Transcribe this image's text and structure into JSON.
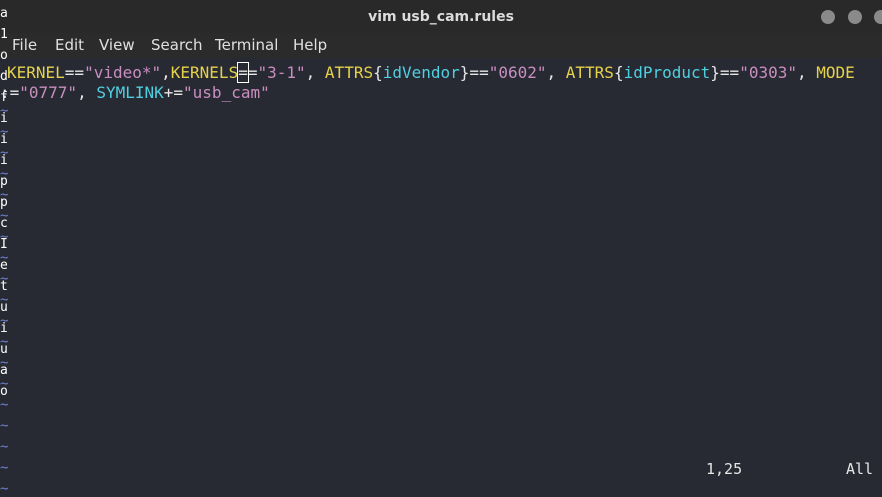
{
  "window": {
    "title": "vim usb_cam.rules"
  },
  "menu": [
    "File",
    "Edit",
    "View",
    "Search",
    "Terminal",
    "Help"
  ],
  "editor": {
    "line1": {
      "t1": "KERNEL",
      "t2": "==",
      "t3": "\"video*\"",
      "t4": ",",
      "t5": "KERNELS",
      "t6": "=",
      "t7": "=",
      "t8": "\"3-1\"",
      "t9": ", ",
      "t10": "ATTRS",
      "t11": "{",
      "t12": "idVendor",
      "t13": "}==",
      "t14": "\"0602\"",
      "t15": ", ",
      "t16": "ATTRS",
      "t17": "{",
      "t18": "idProduct",
      "t19": "}==",
      "t20": "\"0303\"",
      "t21": ", ",
      "t22": "MODE"
    },
    "line2": {
      "t1": ":=",
      "t2": "\"0777\"",
      "t3": ", ",
      "t4": "SYMLINK",
      "t5": "+=",
      "t6": "\"usb_cam\""
    },
    "tilde": "~",
    "left_edge_chars": [
      "a",
      "1",
      "o",
      "d",
      "f",
      "i",
      "i",
      "i",
      "p",
      "p",
      "c",
      "I",
      "e",
      "t",
      "u",
      "i",
      "u",
      "a",
      "o"
    ]
  },
  "status": {
    "position": "1,25",
    "scroll": "All"
  },
  "colors": {
    "keyword": "#e6d24a",
    "string": "#c98ec0",
    "attribute_key": "#4fd0e0",
    "tilde": "#6a7fd0",
    "background": "#282a33"
  }
}
